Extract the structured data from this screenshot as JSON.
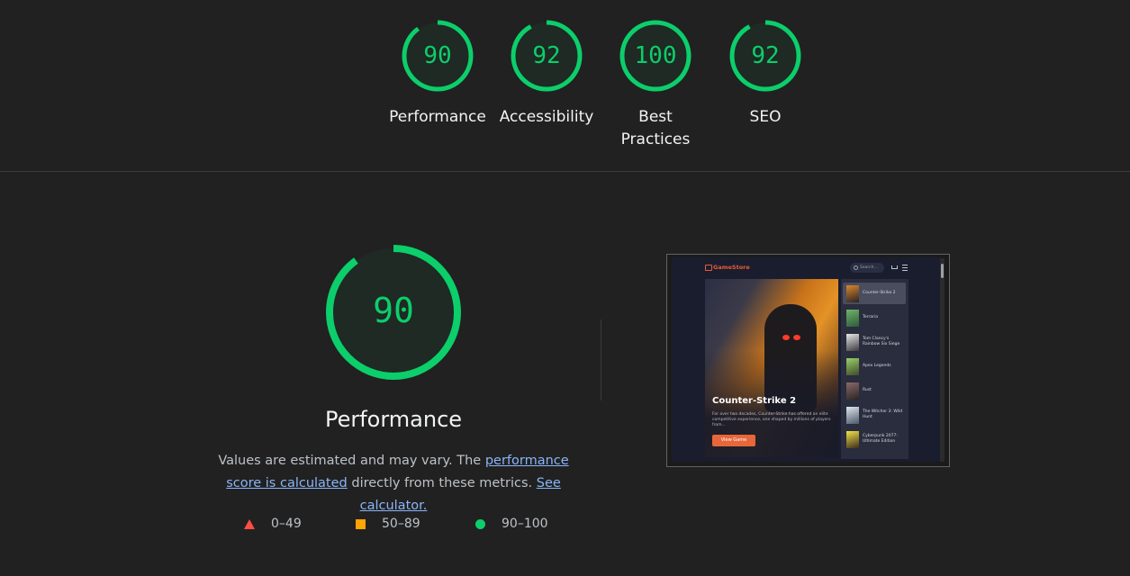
{
  "summary": [
    {
      "score": "90",
      "label": "Performance"
    },
    {
      "score": "92",
      "label": "Accessibility"
    },
    {
      "score": "100",
      "label": "Best Practices"
    },
    {
      "score": "92",
      "label": "SEO"
    }
  ],
  "detail": {
    "score": "90",
    "title": "Performance",
    "desc_before": "Values are estimated and may vary. The ",
    "desc_link1": "performance score is calculated",
    "desc_middle": " directly from these metrics. ",
    "desc_link2": "See calculator."
  },
  "legend": [
    {
      "shape": "triangle",
      "label": "0–49",
      "color": "#ff4e42"
    },
    {
      "shape": "square",
      "label": "50–89",
      "color": "#ffa400"
    },
    {
      "shape": "circle",
      "label": "90–100",
      "color": "#0cce6b"
    }
  ],
  "colors": {
    "pass": "#0cce6b",
    "track": "#1e3a2b",
    "background": "#212121"
  },
  "screenshot": {
    "brand": "GameStore",
    "search_placeholder": "Search...",
    "hero_title": "Counter-Strike 2",
    "hero_desc": "For over two decades, Counter-Strike has offered an elite competitive experience, one shaped by millions of players from...",
    "hero_button": "View Game",
    "games": [
      "Counter-Strike 2",
      "Terraria",
      "Tom Clancy's Rainbow Six Siege",
      "Apex Legends",
      "Rust",
      "The Witcher 3: Wild Hunt",
      "Cyberpunk 2077: Ultimate Edition"
    ]
  }
}
